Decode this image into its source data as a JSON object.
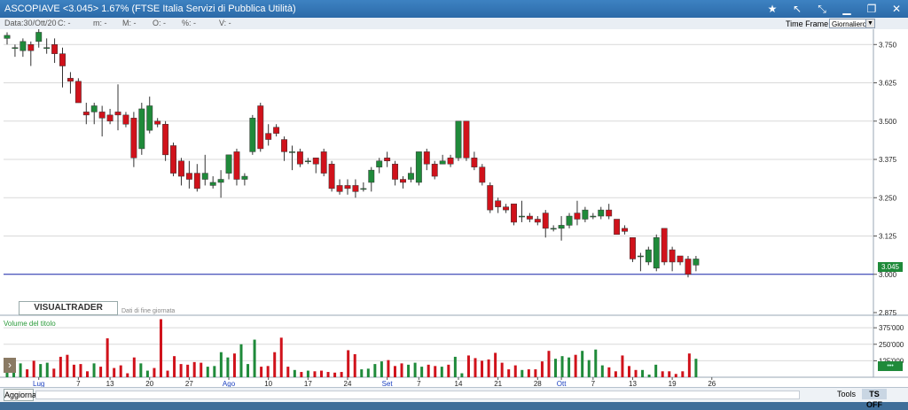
{
  "window": {
    "title": "ASCOPIAVE <3.045> 1.67% (FTSE Italia Servizi di Pubblica Utilità)"
  },
  "infobar": {
    "date": "Data:30/Ott/20",
    "c": "C: -",
    "m": "m: -",
    "M": "M: -",
    "O": "O: -",
    "pct": "%: -",
    "V": "V: -"
  },
  "timeframe": {
    "label": "Time Frame",
    "value": "Giornaliero"
  },
  "brand": {
    "logo": "VISUALTRADER",
    "subtitle": "Dati di fine giornata"
  },
  "volume_panel": {
    "label": "Volume del titolo"
  },
  "bottom": {
    "update": "Aggiorna",
    "tools": "Tools",
    "tsoff": "TS OFF"
  },
  "colors": {
    "up": "#1f8a3a",
    "down": "#d0121b",
    "grid": "#d9d9d9"
  },
  "chart_data": {
    "type": "candlestick",
    "x_ticks": [
      {
        "i": 4,
        "label": "Lug",
        "blue": true
      },
      {
        "i": 9,
        "label": "7"
      },
      {
        "i": 13,
        "label": "13"
      },
      {
        "i": 18,
        "label": "20"
      },
      {
        "i": 23,
        "label": "27"
      },
      {
        "i": 28,
        "label": "Ago",
        "blue": true
      },
      {
        "i": 33,
        "label": "10"
      },
      {
        "i": 38,
        "label": "17"
      },
      {
        "i": 43,
        "label": "24"
      },
      {
        "i": 48,
        "label": "Set",
        "blue": true
      },
      {
        "i": 52,
        "label": "7"
      },
      {
        "i": 57,
        "label": "14"
      },
      {
        "i": 62,
        "label": "21"
      },
      {
        "i": 67,
        "label": "28"
      },
      {
        "i": 70,
        "label": "Ott",
        "blue": true
      },
      {
        "i": 74,
        "label": "7"
      },
      {
        "i": 79,
        "label": "13"
      },
      {
        "i": 84,
        "label": "19"
      },
      {
        "i": 89,
        "label": "26"
      }
    ],
    "price_axis": {
      "ticks": [
        3.75,
        3.625,
        3.5,
        3.375,
        3.25,
        3.125,
        3.0,
        2.875
      ],
      "labels": [
        "3.750",
        "3.625",
        "3.500",
        "3.375",
        "3.250",
        "3.125",
        "3.000",
        "2.875"
      ],
      "range": [
        2.875,
        3.8
      ]
    },
    "volume_axis": {
      "ticks": [
        375000,
        250000,
        125000
      ],
      "labels": [
        "375'000",
        "250'000",
        "125'000"
      ],
      "max": 470000
    },
    "last_price": "3.045",
    "reference_line": 3.0,
    "candles": [
      {
        "o": 3.77,
        "h": 3.79,
        "l": 3.75,
        "c": 3.78
      },
      {
        "o": 3.74,
        "h": 3.75,
        "l": 3.71,
        "c": 3.74
      },
      {
        "o": 3.73,
        "h": 3.77,
        "l": 3.71,
        "c": 3.76
      },
      {
        "o": 3.75,
        "h": 3.76,
        "l": 3.68,
        "c": 3.73
      },
      {
        "o": 3.76,
        "h": 3.82,
        "l": 3.74,
        "c": 3.79
      },
      {
        "o": 3.74,
        "h": 3.77,
        "l": 3.72,
        "c": 3.74
      },
      {
        "o": 3.75,
        "h": 3.77,
        "l": 3.69,
        "c": 3.72
      },
      {
        "o": 3.72,
        "h": 3.74,
        "l": 3.61,
        "c": 3.68
      },
      {
        "o": 3.64,
        "h": 3.66,
        "l": 3.59,
        "c": 3.63
      },
      {
        "o": 3.63,
        "h": 3.64,
        "l": 3.56,
        "c": 3.56
      },
      {
        "o": 3.53,
        "h": 3.56,
        "l": 3.49,
        "c": 3.52
      },
      {
        "o": 3.53,
        "h": 3.56,
        "l": 3.49,
        "c": 3.55
      },
      {
        "o": 3.53,
        "h": 3.55,
        "l": 3.45,
        "c": 3.51
      },
      {
        "o": 3.52,
        "h": 3.54,
        "l": 3.49,
        "c": 3.5
      },
      {
        "o": 3.53,
        "h": 3.62,
        "l": 3.47,
        "c": 3.52
      },
      {
        "o": 3.52,
        "h": 3.53,
        "l": 3.48,
        "c": 3.49
      },
      {
        "o": 3.51,
        "h": 3.53,
        "l": 3.35,
        "c": 3.38
      },
      {
        "o": 3.41,
        "h": 3.56,
        "l": 3.39,
        "c": 3.54
      },
      {
        "o": 3.47,
        "h": 3.58,
        "l": 3.46,
        "c": 3.55
      },
      {
        "o": 3.5,
        "h": 3.51,
        "l": 3.48,
        "c": 3.49
      },
      {
        "o": 3.49,
        "h": 3.5,
        "l": 3.37,
        "c": 3.39
      },
      {
        "o": 3.42,
        "h": 3.43,
        "l": 3.32,
        "c": 3.33
      },
      {
        "o": 3.37,
        "h": 3.38,
        "l": 3.29,
        "c": 3.32
      },
      {
        "o": 3.33,
        "h": 3.37,
        "l": 3.28,
        "c": 3.31
      },
      {
        "o": 3.33,
        "h": 3.36,
        "l": 3.27,
        "c": 3.28
      },
      {
        "o": 3.31,
        "h": 3.39,
        "l": 3.29,
        "c": 3.33
      },
      {
        "o": 3.29,
        "h": 3.32,
        "l": 3.28,
        "c": 3.3
      },
      {
        "o": 3.3,
        "h": 3.34,
        "l": 3.25,
        "c": 3.31
      },
      {
        "o": 3.33,
        "h": 3.39,
        "l": 3.31,
        "c": 3.39
      },
      {
        "o": 3.4,
        "h": 3.41,
        "l": 3.29,
        "c": 3.31
      },
      {
        "o": 3.31,
        "h": 3.33,
        "l": 3.29,
        "c": 3.32
      },
      {
        "o": 3.4,
        "h": 3.52,
        "l": 3.39,
        "c": 3.51
      },
      {
        "o": 3.55,
        "h": 3.56,
        "l": 3.4,
        "c": 3.41
      },
      {
        "o": 3.46,
        "h": 3.49,
        "l": 3.42,
        "c": 3.44
      },
      {
        "o": 3.48,
        "h": 3.49,
        "l": 3.45,
        "c": 3.46
      },
      {
        "o": 3.44,
        "h": 3.45,
        "l": 3.37,
        "c": 3.4
      },
      {
        "o": 3.4,
        "h": 3.42,
        "l": 3.34,
        "c": 3.4
      },
      {
        "o": 3.4,
        "h": 3.41,
        "l": 3.35,
        "c": 3.36
      },
      {
        "o": 3.37,
        "h": 3.38,
        "l": 3.36,
        "c": 3.37
      },
      {
        "o": 3.38,
        "h": 3.38,
        "l": 3.33,
        "c": 3.36
      },
      {
        "o": 3.4,
        "h": 3.41,
        "l": 3.32,
        "c": 3.33
      },
      {
        "o": 3.36,
        "h": 3.37,
        "l": 3.27,
        "c": 3.28
      },
      {
        "o": 3.29,
        "h": 3.31,
        "l": 3.26,
        "c": 3.27
      },
      {
        "o": 3.29,
        "h": 3.31,
        "l": 3.26,
        "c": 3.28
      },
      {
        "o": 3.29,
        "h": 3.31,
        "l": 3.25,
        "c": 3.27
      },
      {
        "o": 3.28,
        "h": 3.3,
        "l": 3.27,
        "c": 3.28
      },
      {
        "o": 3.3,
        "h": 3.35,
        "l": 3.27,
        "c": 3.34
      },
      {
        "o": 3.35,
        "h": 3.38,
        "l": 3.33,
        "c": 3.37
      },
      {
        "o": 3.38,
        "h": 3.4,
        "l": 3.35,
        "c": 3.37
      },
      {
        "o": 3.36,
        "h": 3.37,
        "l": 3.29,
        "c": 3.31
      },
      {
        "o": 3.31,
        "h": 3.32,
        "l": 3.28,
        "c": 3.3
      },
      {
        "o": 3.31,
        "h": 3.35,
        "l": 3.3,
        "c": 3.33
      },
      {
        "o": 3.3,
        "h": 3.4,
        "l": 3.29,
        "c": 3.4
      },
      {
        "o": 3.4,
        "h": 3.41,
        "l": 3.34,
        "c": 3.36
      },
      {
        "o": 3.36,
        "h": 3.37,
        "l": 3.31,
        "c": 3.32
      },
      {
        "o": 3.36,
        "h": 3.39,
        "l": 3.36,
        "c": 3.37
      },
      {
        "o": 3.38,
        "h": 3.39,
        "l": 3.35,
        "c": 3.36
      },
      {
        "o": 3.38,
        "h": 3.5,
        "l": 3.37,
        "c": 3.5
      },
      {
        "o": 3.5,
        "h": 3.5,
        "l": 3.37,
        "c": 3.38
      },
      {
        "o": 3.38,
        "h": 3.4,
        "l": 3.34,
        "c": 3.35
      },
      {
        "o": 3.35,
        "h": 3.36,
        "l": 3.29,
        "c": 3.3
      },
      {
        "o": 3.29,
        "h": 3.3,
        "l": 3.2,
        "c": 3.21
      },
      {
        "o": 3.24,
        "h": 3.25,
        "l": 3.2,
        "c": 3.22
      },
      {
        "o": 3.22,
        "h": 3.23,
        "l": 3.2,
        "c": 3.21
      },
      {
        "o": 3.23,
        "h": 3.23,
        "l": 3.16,
        "c": 3.17
      },
      {
        "o": 3.19,
        "h": 3.24,
        "l": 3.17,
        "c": 3.19
      },
      {
        "o": 3.19,
        "h": 3.2,
        "l": 3.17,
        "c": 3.18
      },
      {
        "o": 3.18,
        "h": 3.19,
        "l": 3.16,
        "c": 3.17
      },
      {
        "o": 3.2,
        "h": 3.21,
        "l": 3.12,
        "c": 3.15
      },
      {
        "o": 3.15,
        "h": 3.16,
        "l": 3.14,
        "c": 3.15
      },
      {
        "o": 3.15,
        "h": 3.19,
        "l": 3.11,
        "c": 3.16
      },
      {
        "o": 3.16,
        "h": 3.2,
        "l": 3.15,
        "c": 3.19
      },
      {
        "o": 3.2,
        "h": 3.24,
        "l": 3.16,
        "c": 3.18
      },
      {
        "o": 3.18,
        "h": 3.22,
        "l": 3.17,
        "c": 3.21
      },
      {
        "o": 3.19,
        "h": 3.2,
        "l": 3.18,
        "c": 3.19
      },
      {
        "o": 3.19,
        "h": 3.22,
        "l": 3.18,
        "c": 3.21
      },
      {
        "o": 3.21,
        "h": 3.23,
        "l": 3.18,
        "c": 3.19
      },
      {
        "o": 3.18,
        "h": 3.18,
        "l": 3.13,
        "c": 3.13
      },
      {
        "o": 3.15,
        "h": 3.16,
        "l": 3.13,
        "c": 3.14
      },
      {
        "o": 3.12,
        "h": 3.12,
        "l": 3.04,
        "c": 3.05
      },
      {
        "o": 3.06,
        "h": 3.07,
        "l": 3.01,
        "c": 3.06
      },
      {
        "o": 3.04,
        "h": 3.09,
        "l": 3.03,
        "c": 3.08
      },
      {
        "o": 3.02,
        "h": 3.13,
        "l": 3.01,
        "c": 3.12
      },
      {
        "o": 3.15,
        "h": 3.15,
        "l": 3.03,
        "c": 3.04
      },
      {
        "o": 3.08,
        "h": 3.09,
        "l": 3.01,
        "c": 3.04
      },
      {
        "o": 3.06,
        "h": 3.06,
        "l": 3.03,
        "c": 3.04
      },
      {
        "o": 3.05,
        "h": 3.06,
        "l": 2.99,
        "c": 3.0
      },
      {
        "o": 3.03,
        "h": 3.06,
        "l": 3.01,
        "c": 3.05
      }
    ],
    "volumes": [
      95000,
      110000,
      105000,
      60000,
      125000,
      100000,
      110000,
      65000,
      155000,
      170000,
      95000,
      100000,
      45000,
      105000,
      80000,
      295000,
      70000,
      90000,
      30000,
      150000,
      105000,
      50000,
      70000,
      440000,
      50000,
      160000,
      100000,
      95000,
      115000,
      110000,
      80000,
      85000,
      190000,
      150000,
      180000,
      250000,
      100000,
      285000,
      80000,
      85000,
      190000,
      300000,
      80000,
      55000,
      40000,
      50000,
      45000,
      50000,
      40000,
      35000,
      40000,
      205000,
      175000,
      60000,
      65000,
      100000,
      120000,
      130000,
      85000,
      105000,
      95000,
      110000,
      80000,
      95000,
      85000,
      80000,
      95000,
      155000,
      30000,
      165000,
      145000,
      125000,
      135000,
      185000,
      110000,
      60000,
      90000,
      55000,
      60000,
      60000,
      120000,
      200000,
      140000,
      160000,
      150000,
      170000,
      200000,
      130000,
      210000,
      90000,
      75000,
      45000,
      165000,
      85000,
      55000,
      55000,
      20000,
      95000,
      45000,
      45000,
      25000,
      45000,
      180000,
      140000
    ]
  }
}
